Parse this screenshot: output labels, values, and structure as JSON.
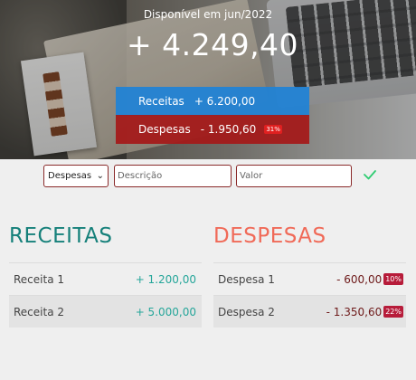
{
  "header": {
    "title": "Disponível em jun/2022",
    "balance": "+ 4.249,40"
  },
  "summary": {
    "receitas": {
      "label": "Receitas",
      "amount": "+ 6.200,00"
    },
    "despesas": {
      "label": "Despesas",
      "amount": "- 1.950,60",
      "percent": "31%"
    }
  },
  "form": {
    "type_selected": "Despesas",
    "description_placeholder": "Descrição",
    "value_placeholder": "Valor"
  },
  "receitas": {
    "title": "RECEITAS",
    "items": [
      {
        "name": "Receita 1",
        "amount": "+ 1.200,00"
      },
      {
        "name": "Receita 2",
        "amount": "+ 5.000,00"
      }
    ]
  },
  "despesas": {
    "title": "DESPESAS",
    "items": [
      {
        "name": "Despesa 1",
        "amount": "- 600,00",
        "percent": "10%"
      },
      {
        "name": "Despesa 2",
        "amount": "- 1.350,60",
        "percent": "22%"
      }
    ]
  },
  "colors": {
    "receitas_bar": "#1e82d7",
    "despesas_bar": "#a51818",
    "receitas_title": "#15807a",
    "despesas_title": "#f06a58",
    "confirm_check": "#2ecc71"
  },
  "icons": {
    "confirm": "check-icon",
    "select": "chevron-down-icon"
  }
}
